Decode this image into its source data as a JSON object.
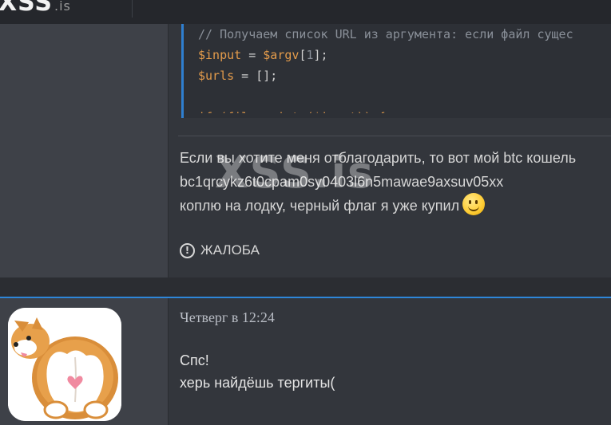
{
  "header": {
    "logo": "XSS",
    "logo_tld": ".is"
  },
  "post1": {
    "code_lines": {
      "comment": "// Получаем список URL из аргумента: если файл сущес",
      "line2": {
        "var1": "$input",
        "op": " = ",
        "var2": "$argv",
        "bracket_open": "[",
        "num": "1",
        "bracket_close": "];"
      },
      "line3": {
        "var1": "$urls",
        "op": " = [];"
      },
      "line5_partial": "if (file_exists($input)) {"
    },
    "signature": {
      "line1": "Если вы хотите меня отблагодарить, то вот мой btc кошель",
      "line2": "bc1qrcykz6t0cpam0sy0403l6n5mawae9axsuv05xx",
      "line3": "коплю на лодку, черный флаг я уже купил"
    },
    "watermark": "XSS.is",
    "report_label": "ЖАЛОБА",
    "report_icon": "!"
  },
  "post2": {
    "timestamp": "Четверг в 12:24",
    "message_lines": [
      "Спс!",
      "херь найдёшь тергиты("
    ]
  },
  "colors": {
    "accent": "#2e86d9",
    "code_var": "#e39b4b",
    "background": "#33363c",
    "sidebar": "#3e4148"
  }
}
